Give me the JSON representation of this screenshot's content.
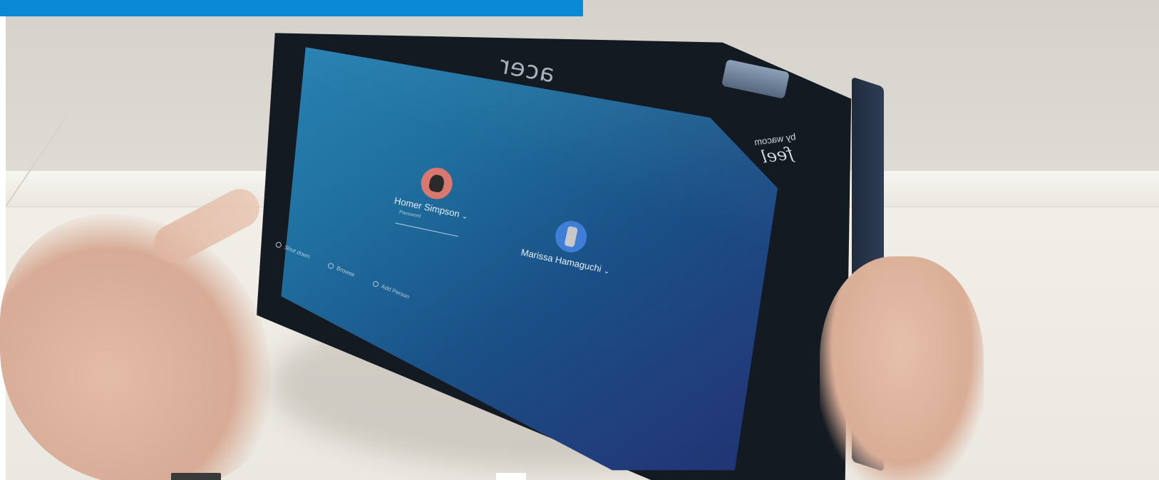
{
  "banner": {
    "color": "#0a8ad6"
  },
  "device": {
    "brand": "acer",
    "pen_brand_small": "by wacom",
    "pen_brand_big": "feel"
  },
  "login_screen": {
    "users": [
      {
        "name": "Homer Simpson",
        "avatar_color": "#d9786f",
        "password_placeholder": "Password"
      },
      {
        "name": "Marissa Hamaguchi",
        "avatar_color": "#3e7ed6"
      }
    ],
    "shelf": {
      "shutdown_label": "Shut down",
      "browse_label": "Browse",
      "add_person_label": "Add Person"
    }
  }
}
